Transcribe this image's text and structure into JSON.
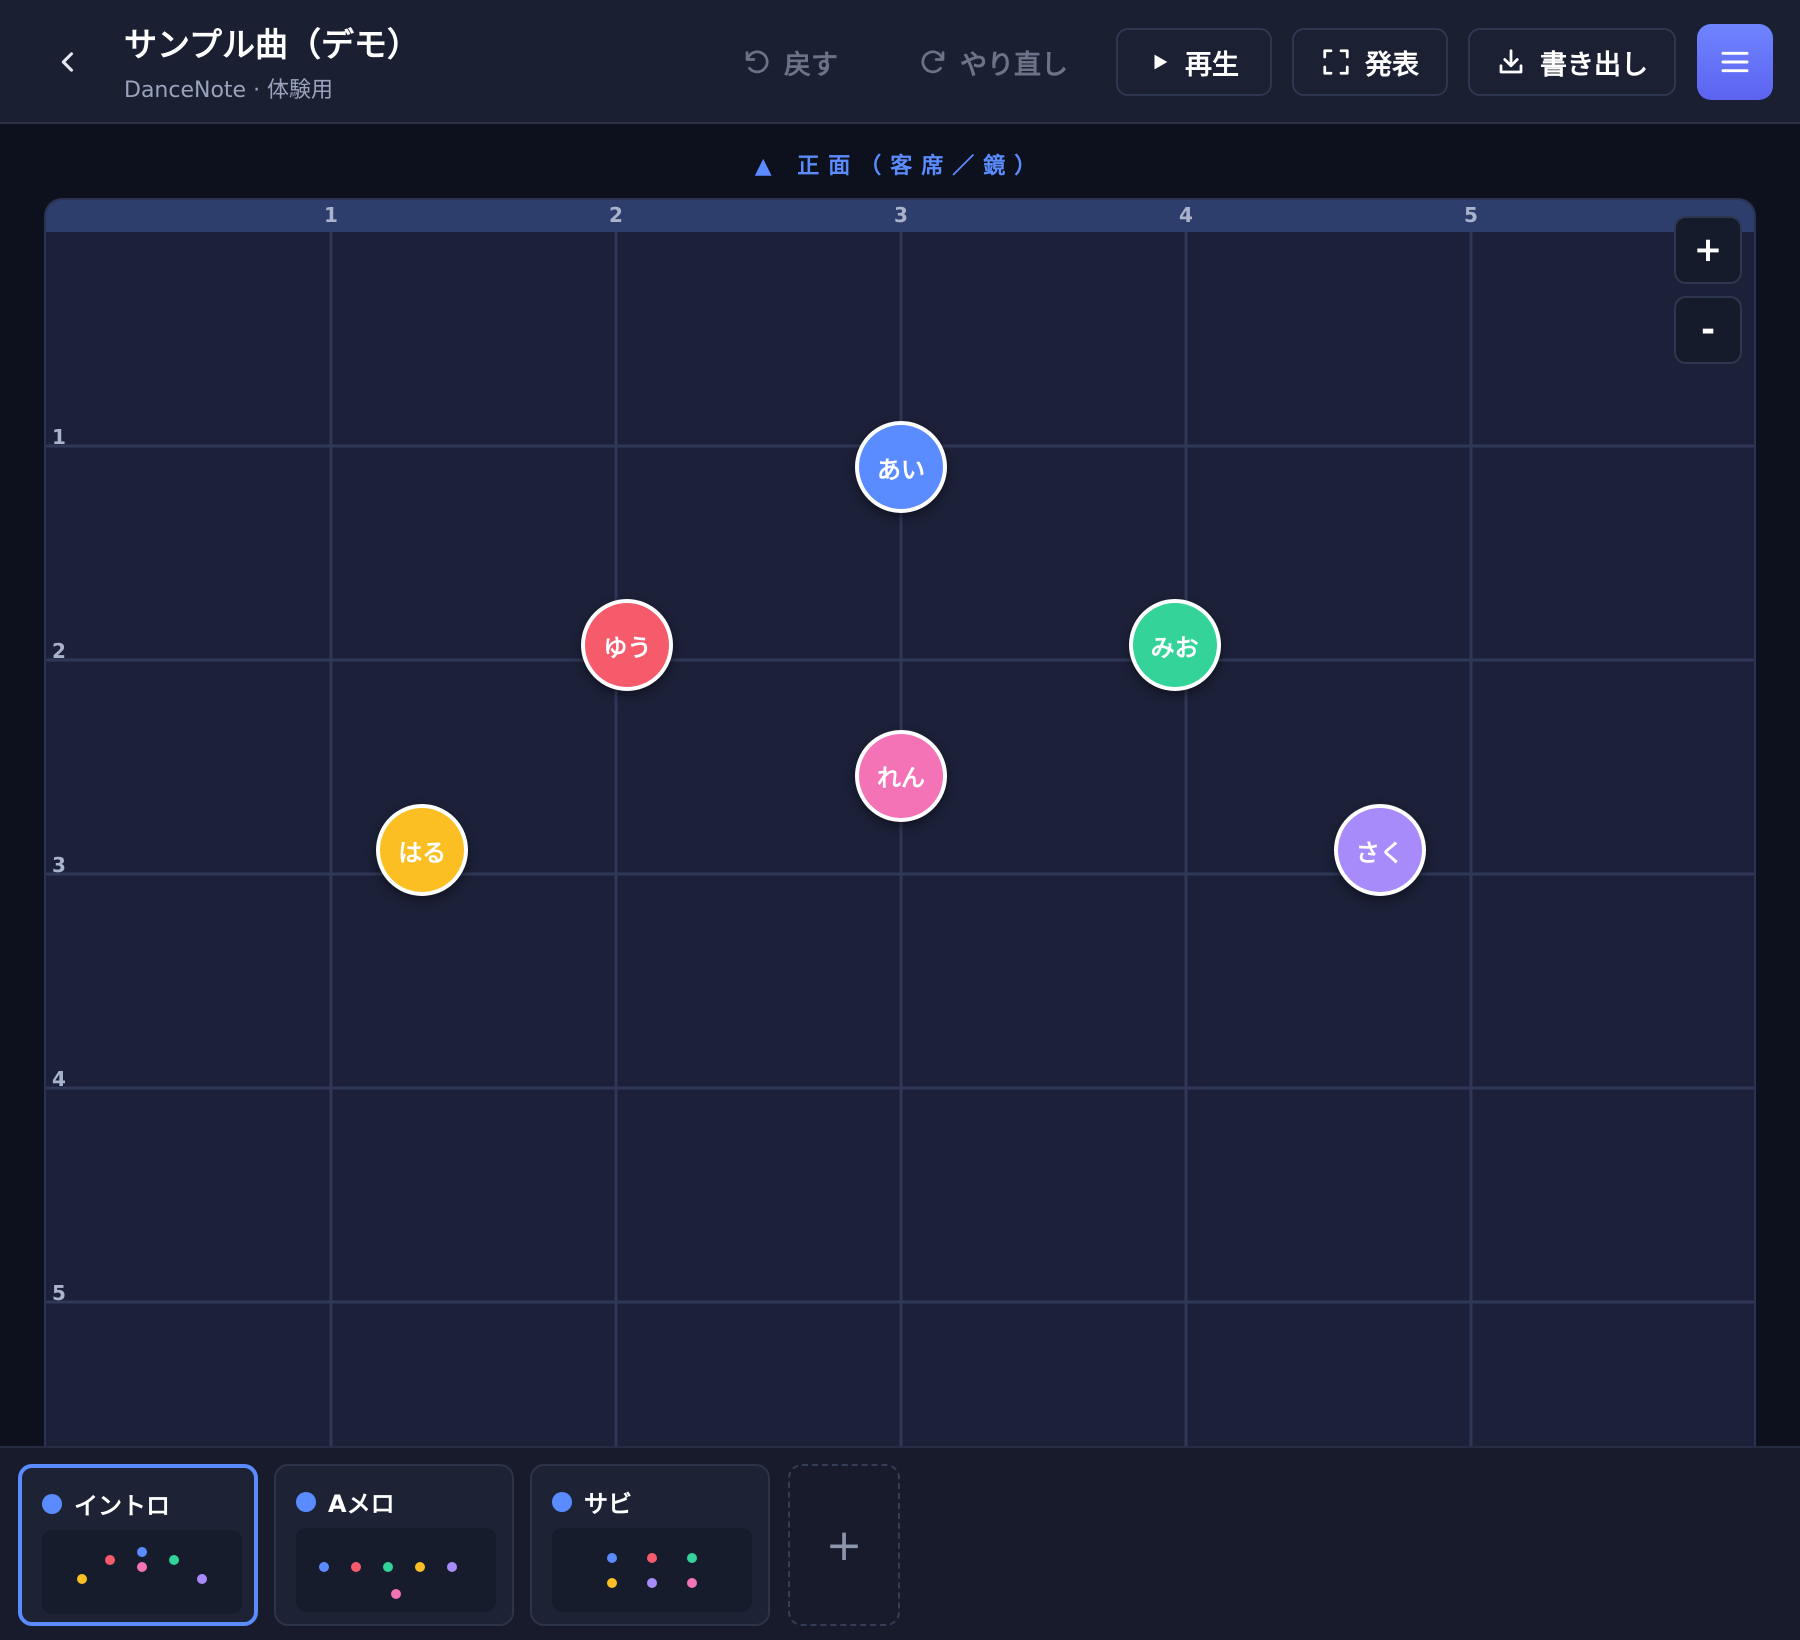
{
  "header": {
    "title": "サンプル曲（デモ）",
    "subtitle": "DanceNote · 体験用",
    "undo_label": "戻す",
    "redo_label": "やり直し",
    "play_label": "再生",
    "present_label": "発表",
    "export_label": "書き出し"
  },
  "stage": {
    "front_label": "▲ 正面（客席／鏡）",
    "col_labels": [
      "1",
      "2",
      "3",
      "4",
      "5"
    ],
    "row_labels": [
      "1",
      "2",
      "3",
      "4",
      "5"
    ],
    "zoom_in_label": "+",
    "zoom_out_label": "-",
    "dancers": [
      {
        "name": "あい",
        "color": "#5b8cff",
        "col": 3.0,
        "row": 1.1
      },
      {
        "name": "ゆう",
        "color": "#f65b6b",
        "col": 2.04,
        "row": 1.93
      },
      {
        "name": "みお",
        "color": "#34d399",
        "col": 3.96,
        "row": 1.93
      },
      {
        "name": "れん",
        "color": "#f472b6",
        "col": 3.0,
        "row": 2.54
      },
      {
        "name": "はる",
        "color": "#fbbf24",
        "col": 1.32,
        "row": 2.89
      },
      {
        "name": "さく",
        "color": "#a78bfa",
        "col": 4.68,
        "row": 2.89
      }
    ]
  },
  "scenes": [
    {
      "label": "イントロ",
      "active": true,
      "dots": [
        [
          0.2,
          0.58
        ],
        [
          0.34,
          0.36
        ],
        [
          0.5,
          0.26
        ],
        [
          0.5,
          0.44
        ],
        [
          0.66,
          0.36
        ],
        [
          0.8,
          0.58
        ]
      ]
    },
    {
      "label": "Aメロ",
      "active": false,
      "dots": [
        [
          0.14,
          0.47
        ],
        [
          0.3,
          0.47
        ],
        [
          0.46,
          0.47
        ],
        [
          0.62,
          0.47
        ],
        [
          0.78,
          0.47
        ],
        [
          0.5,
          0.78
        ]
      ]
    },
    {
      "label": "サビ",
      "active": false,
      "dots": [
        [
          0.3,
          0.36
        ],
        [
          0.5,
          0.36
        ],
        [
          0.7,
          0.36
        ],
        [
          0.3,
          0.66
        ],
        [
          0.5,
          0.66
        ],
        [
          0.7,
          0.66
        ]
      ]
    }
  ],
  "add_scene_label": "+",
  "colors": {
    "accent": "#5b8cff",
    "background": "#0d111d",
    "stage": "#1c2139",
    "dancer_palette": [
      "#5b8cff",
      "#f65b6b",
      "#34d399",
      "#fbbf24",
      "#f472b6",
      "#a78bfa"
    ]
  },
  "icons": {
    "back": "chevron-left-icon",
    "undo": "undo-icon",
    "redo": "redo-icon",
    "play": "play-icon",
    "present": "fullscreen-icon",
    "export": "download-icon",
    "menu": "hamburger-menu-icon"
  }
}
